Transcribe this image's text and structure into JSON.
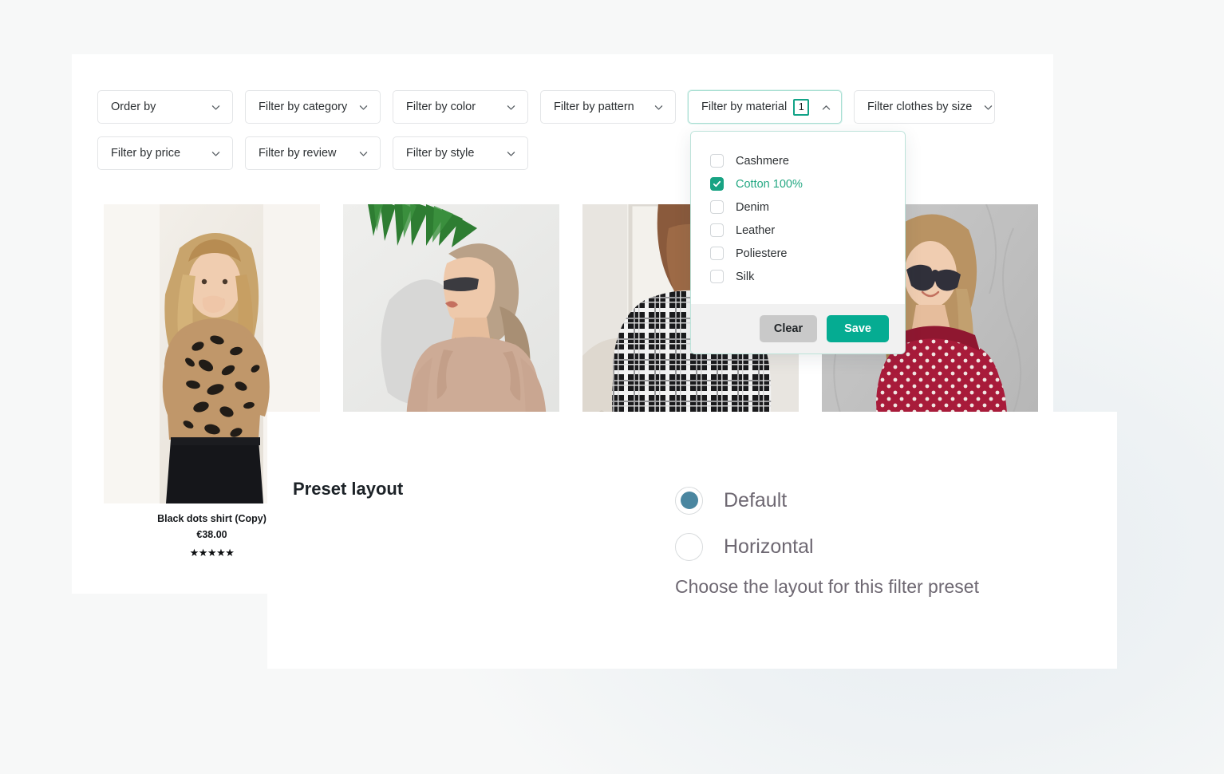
{
  "filters": {
    "row1": [
      {
        "label": "Order by",
        "icon": "chevron-down-icon",
        "name": "order-by"
      },
      {
        "label": "Filter by category",
        "icon": "chevron-down-icon",
        "name": "filter-category"
      },
      {
        "label": "Filter by color",
        "icon": "chevron-down-icon",
        "name": "filter-color"
      },
      {
        "label": "Filter by pattern",
        "icon": "chevron-down-icon",
        "name": "filter-pattern"
      }
    ],
    "material": {
      "label": "Filter by material",
      "count": "1",
      "icon": "chevron-up-icon",
      "expanded": true
    },
    "size": {
      "label": "Filter clothes by size",
      "icon": "chevron-down-icon"
    },
    "row2": [
      {
        "label": "Filter by price",
        "icon": "chevron-down-icon",
        "name": "filter-price"
      },
      {
        "label": "Filter by review",
        "icon": "chevron-down-icon",
        "name": "filter-review"
      },
      {
        "label": "Filter by style",
        "icon": "chevron-down-icon",
        "name": "filter-style"
      }
    ]
  },
  "material_dropdown": {
    "options": [
      {
        "label": "Cashmere",
        "checked": false
      },
      {
        "label": "Cotton 100%",
        "checked": true
      },
      {
        "label": "Denim",
        "checked": false
      },
      {
        "label": "Leather",
        "checked": false
      },
      {
        "label": "Poliestere",
        "checked": false
      },
      {
        "label": "Silk",
        "checked": false
      }
    ],
    "clear_label": "Clear",
    "save_label": "Save",
    "accent_color": "#05ac92",
    "checked_color": "#18a383",
    "selected_text_color": "#25a883"
  },
  "products": [
    {
      "title": "Black dots shirt (Copy)",
      "price": "€38.00",
      "rating": "★★★★★",
      "photo": "floral-mesh-top-woman"
    },
    {
      "title": "",
      "price": "",
      "rating": "",
      "photo": "beige-ruffle-blouse-woman"
    },
    {
      "title": "",
      "price": "",
      "rating": "",
      "photo": "plaid-check-top-woman-back"
    },
    {
      "title": "",
      "price": "",
      "rating": "",
      "photo": "red-polka-dot-off-shoulder-woman"
    }
  ],
  "preset": {
    "title": "Preset layout",
    "options": [
      {
        "label": "Default",
        "selected": true
      },
      {
        "label": "Horizontal",
        "selected": false
      }
    ],
    "help_text": "Choose the layout for this filter preset",
    "selected_color": "#4a86a0"
  }
}
